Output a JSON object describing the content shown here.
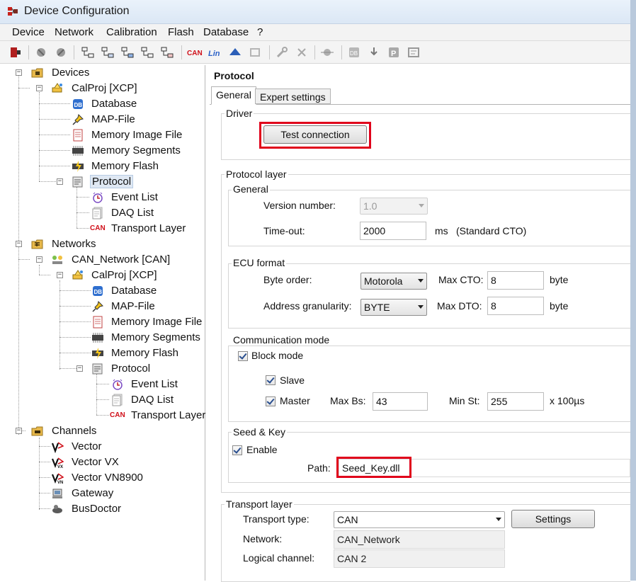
{
  "window": {
    "title": "Device Configuration"
  },
  "menu": [
    "Device",
    "Network",
    "Calibration",
    "Flash",
    "Database",
    "?"
  ],
  "toolbar_icons": [
    "exit-icon",
    "device-add-icon",
    "device-remove-icon",
    "protocol-icon-1",
    "protocol-icon-2",
    "protocol-icon-3",
    "protocol-icon-4",
    "protocol-icon-5",
    "can-icon",
    "lin-icon",
    "flexray-icon",
    "ethernet-icon",
    "wrench-icon",
    "delete-icon",
    "link-icon",
    "database-icon",
    "download-icon",
    "parking-icon",
    "properties-icon"
  ],
  "tree": {
    "devices": "Devices",
    "calproj": "CalProj [XCP]",
    "database": "Database",
    "map_file": "MAP-File",
    "memory_image_file": "Memory Image File",
    "memory_segments": "Memory Segments",
    "memory_flash": "Memory Flash",
    "protocol": "Protocol",
    "event_list": "Event List",
    "daq_list": "DAQ List",
    "transport_layer": "Transport Layer",
    "networks": "Networks",
    "can_network": "CAN_Network [CAN]",
    "channels": "Channels",
    "vector": "Vector",
    "vector_vx": "Vector VX",
    "vector_vn8900": "Vector VN8900",
    "gateway": "Gateway",
    "busdoctor": "BusDoctor",
    "can_badge": "CAN"
  },
  "panel": {
    "heading": "Protocol",
    "tabs": [
      "General",
      "Expert settings"
    ],
    "driver": {
      "title": "Driver",
      "test_button": "Test connection"
    },
    "protocol_layer": {
      "title": "Protocol layer",
      "general": {
        "title": "General",
        "version_label": "Version number:",
        "version_value": "1.0",
        "timeout_label": "Time-out:",
        "timeout_value": "2000",
        "timeout_unit": "ms",
        "timeout_note": "(Standard CTO)"
      },
      "ecu": {
        "title": "ECU format",
        "byte_order_label": "Byte order:",
        "byte_order_value": "Motorola",
        "max_cto_label": "Max CTO:",
        "max_cto_value": "8",
        "max_cto_unit": "byte",
        "addr_gran_label": "Address granularity:",
        "addr_gran_value": "BYTE",
        "max_dto_label": "Max DTO:",
        "max_dto_value": "8",
        "max_dto_unit": "byte"
      },
      "comm": {
        "title": "Communication mode",
        "block_mode": "Block mode",
        "slave": "Slave",
        "master": "Master",
        "max_bs_label": "Max Bs:",
        "max_bs_value": "43",
        "min_st_label": "Min St:",
        "min_st_value": "255",
        "min_st_unit": "x 100µs"
      },
      "seed": {
        "title": "Seed & Key",
        "enable": "Enable",
        "path_label": "Path:",
        "path_value": "Seed_Key.dll"
      }
    },
    "transport": {
      "title": "Transport layer",
      "type_label": "Transport type:",
      "type_value": "CAN",
      "settings_button": "Settings",
      "network_label": "Network:",
      "network_value": "CAN_Network",
      "channel_label": "Logical channel:",
      "channel_value": "CAN 2"
    }
  },
  "colors": {
    "highlight_box": "#e0001b",
    "title_bar": "#dbe7f5"
  }
}
